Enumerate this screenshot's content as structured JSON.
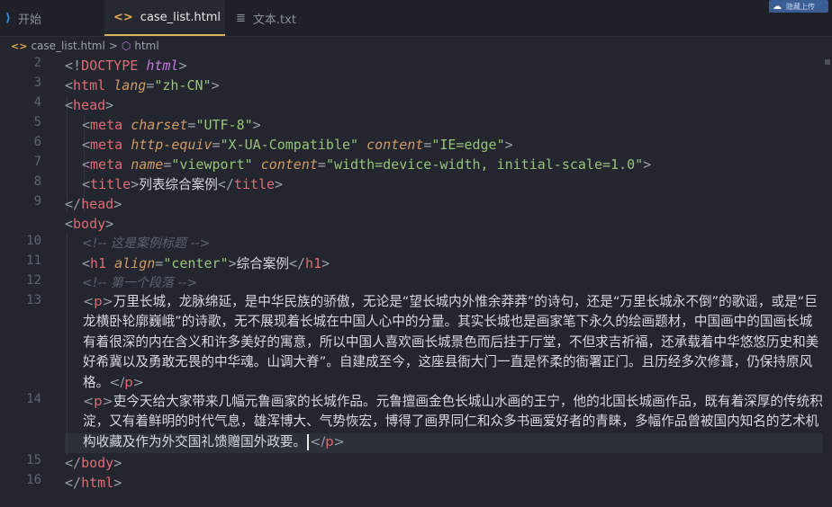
{
  "tabs": [
    {
      "icon": "vscode-icon",
      "label": "开始",
      "active": false
    },
    {
      "icon": "html-code-icon",
      "label": "case_list.html",
      "active": true,
      "modified": true
    },
    {
      "icon": "text-file-icon",
      "label": "文本.txt",
      "active": false
    }
  ],
  "upload_label": "隐藏上传",
  "breadcrumb": {
    "file": "case_list.html",
    "separator": ">",
    "node": "html"
  },
  "line_numbers": [
    "2",
    "3",
    "4",
    "5",
    "6",
    "7",
    "8",
    "9",
    "10",
    "11",
    "12",
    "13",
    "14",
    "15",
    "16"
  ],
  "code": {
    "l2": {
      "open": "<!",
      "name": "DOCTYPE",
      "kw": "html",
      "close": ">"
    },
    "l3": {
      "open": "<",
      "name": "html",
      "attr": "lang",
      "eq": "=",
      "val": "\"zh-CN\"",
      "close": ">"
    },
    "l4": {
      "open": "<",
      "name": "head",
      "close": ">"
    },
    "l5": {
      "open": "<",
      "name": "meta",
      "attr": "charset",
      "eq": "=",
      "val": "\"UTF-8\"",
      "close": ">"
    },
    "l6": {
      "open": "<",
      "name": "meta",
      "attr": "http-equiv",
      "eq": "=",
      "val": "\"X-UA-Compatible\"",
      "attr2": "content",
      "val2": "\"IE=edge\"",
      "close": ">"
    },
    "l7": {
      "open": "<",
      "name": "meta",
      "attr": "name",
      "eq": "=",
      "val": "\"viewport\"",
      "attr2": "content",
      "val2": "\"width=device-width, initial-scale=1.0\"",
      "close": ">"
    },
    "l8": {
      "open": "<",
      "name": "title",
      "close": ">",
      "text": "列表综合案例",
      "end_open": "</",
      "end_close": ">"
    },
    "l9": {
      "open": "</",
      "name": "head",
      "close": ">"
    },
    "l10": {
      "open": "<",
      "name": "body",
      "close": ">"
    },
    "l11": {
      "comment": "<!-- 这是案例标题 -->"
    },
    "l12": {
      "open": "<",
      "name": "h1",
      "attr": "align",
      "eq": "=",
      "val": "\"center\"",
      "close": ">",
      "text": "综合案例",
      "end_open": "</",
      "end_close": ">"
    },
    "l13": {
      "comment": "<!-- 第一个段落 -->"
    },
    "p1": {
      "open": "<",
      "name": "p",
      "close": ">",
      "text": "万里长城，龙脉绵延，是中华民族的骄傲，无论是“望长城内外惟余莽莽”的诗句，还是“万里长城永不倒”的歌谣，或是“巨龙横卧轮廓巍峨”的诗歌，无不展现着长城在中国人心中的分量。其实长城也是画家笔下永久的绘画题材，中国画中的国画长城有着很深的内在含义和许多美好的寓意，所以中国人喜欢画长城景色而后挂于厅堂，不但求吉祈福，还承载着中华悠悠历史和美好希冀以及勇敢无畏的中华魂。山调大脊”。自建成至今，这座县衙大门一直是怀柔的衙署正门。且历经多次修葺，仍保持原风格。",
      "end_open": "</",
      "end_close": ">"
    },
    "p2": {
      "open": "<",
      "name": "p",
      "close": ">",
      "text": "吏今天给大家带来几幅元鲁画家的长城作品。元鲁擅画金色长城山水画的王宁，他的北国长城画作品，既有着深厚的传统积淀，又有着鲜明的时代气息，雄浑博大、气势恢宏，博得了画界同仁和众多书画爱好者的青睐，多幅作品曾被国内知名的艺术机构收藏及作为外交国礼馈赠国外政要。",
      "end_open": "</",
      "end_close": ">"
    },
    "l15": {
      "open": "</",
      "name": "body",
      "close": ">"
    },
    "l16": {
      "open": "</",
      "name": "html",
      "close": ">"
    }
  }
}
